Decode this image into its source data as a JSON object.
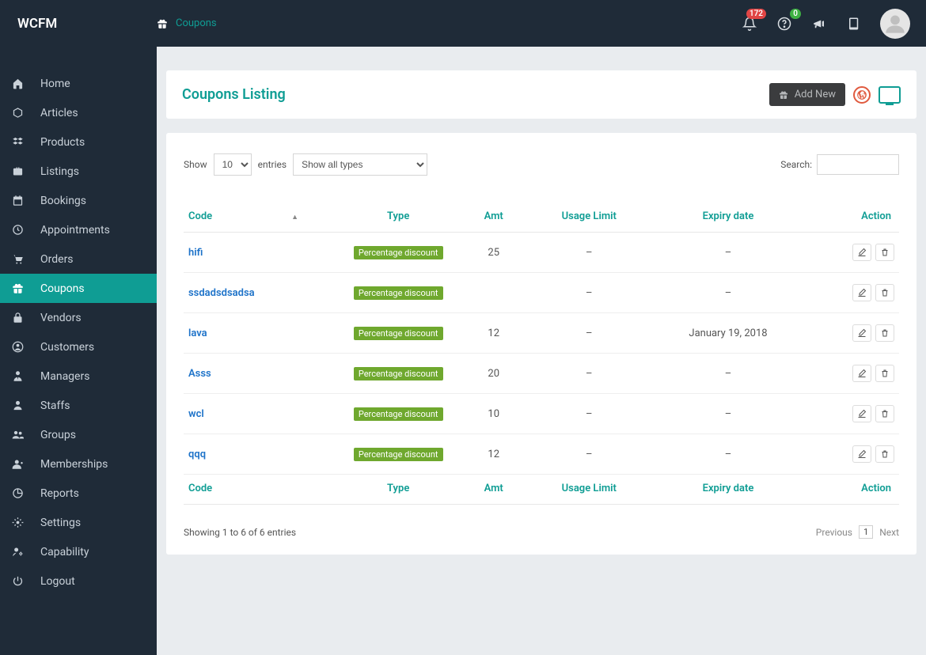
{
  "brand": "WCFM",
  "breadcrumb": "Coupons",
  "topbar": {
    "bellBadge": "172",
    "helpBadge": "0"
  },
  "sidebar": {
    "items": [
      {
        "label": "Home",
        "icon": "home"
      },
      {
        "label": "Articles",
        "icon": "cube"
      },
      {
        "label": "Products",
        "icon": "cubes"
      },
      {
        "label": "Listings",
        "icon": "briefcase"
      },
      {
        "label": "Bookings",
        "icon": "calendar"
      },
      {
        "label": "Appointments",
        "icon": "clock"
      },
      {
        "label": "Orders",
        "icon": "cart"
      },
      {
        "label": "Coupons",
        "icon": "gift"
      },
      {
        "label": "Vendors",
        "icon": "lock"
      },
      {
        "label": "Customers",
        "icon": "user-circle"
      },
      {
        "label": "Managers",
        "icon": "user-tie"
      },
      {
        "label": "Staffs",
        "icon": "user"
      },
      {
        "label": "Groups",
        "icon": "users"
      },
      {
        "label": "Memberships",
        "icon": "user-plus"
      },
      {
        "label": "Reports",
        "icon": "chart"
      },
      {
        "label": "Settings",
        "icon": "cogs"
      },
      {
        "label": "Capability",
        "icon": "user-cog"
      },
      {
        "label": "Logout",
        "icon": "power"
      }
    ],
    "activeIndex": 7
  },
  "page": {
    "title": "Coupons Listing",
    "addNew": "Add New"
  },
  "listing": {
    "showLabel": "Show",
    "entriesLabel": "entries",
    "pageSize": "10",
    "typeFilter": "Show all types",
    "searchLabel": "Search:",
    "searchValue": "",
    "columns": {
      "code": "Code",
      "type": "Type",
      "amt": "Amt",
      "usage": "Usage Limit",
      "expiry": "Expiry date",
      "action": "Action"
    },
    "rows": [
      {
        "code": "hifi",
        "type": "Percentage discount",
        "amt": "25",
        "usage": "–",
        "expiry": "–"
      },
      {
        "code": "ssdadsdsadsa",
        "type": "Percentage discount",
        "amt": "",
        "usage": "–",
        "expiry": "–"
      },
      {
        "code": "lava",
        "type": "Percentage discount",
        "amt": "12",
        "usage": "–",
        "expiry": "January 19, 2018"
      },
      {
        "code": "Asss",
        "type": "Percentage discount",
        "amt": "20",
        "usage": "–",
        "expiry": "–"
      },
      {
        "code": "wcl",
        "type": "Percentage discount",
        "amt": "10",
        "usage": "–",
        "expiry": "–"
      },
      {
        "code": "qqq",
        "type": "Percentage discount",
        "amt": "12",
        "usage": "–",
        "expiry": "–"
      }
    ],
    "info": "Showing 1 to 6 of 6 entries",
    "pager": {
      "prev": "Previous",
      "page": "1",
      "next": "Next"
    }
  }
}
